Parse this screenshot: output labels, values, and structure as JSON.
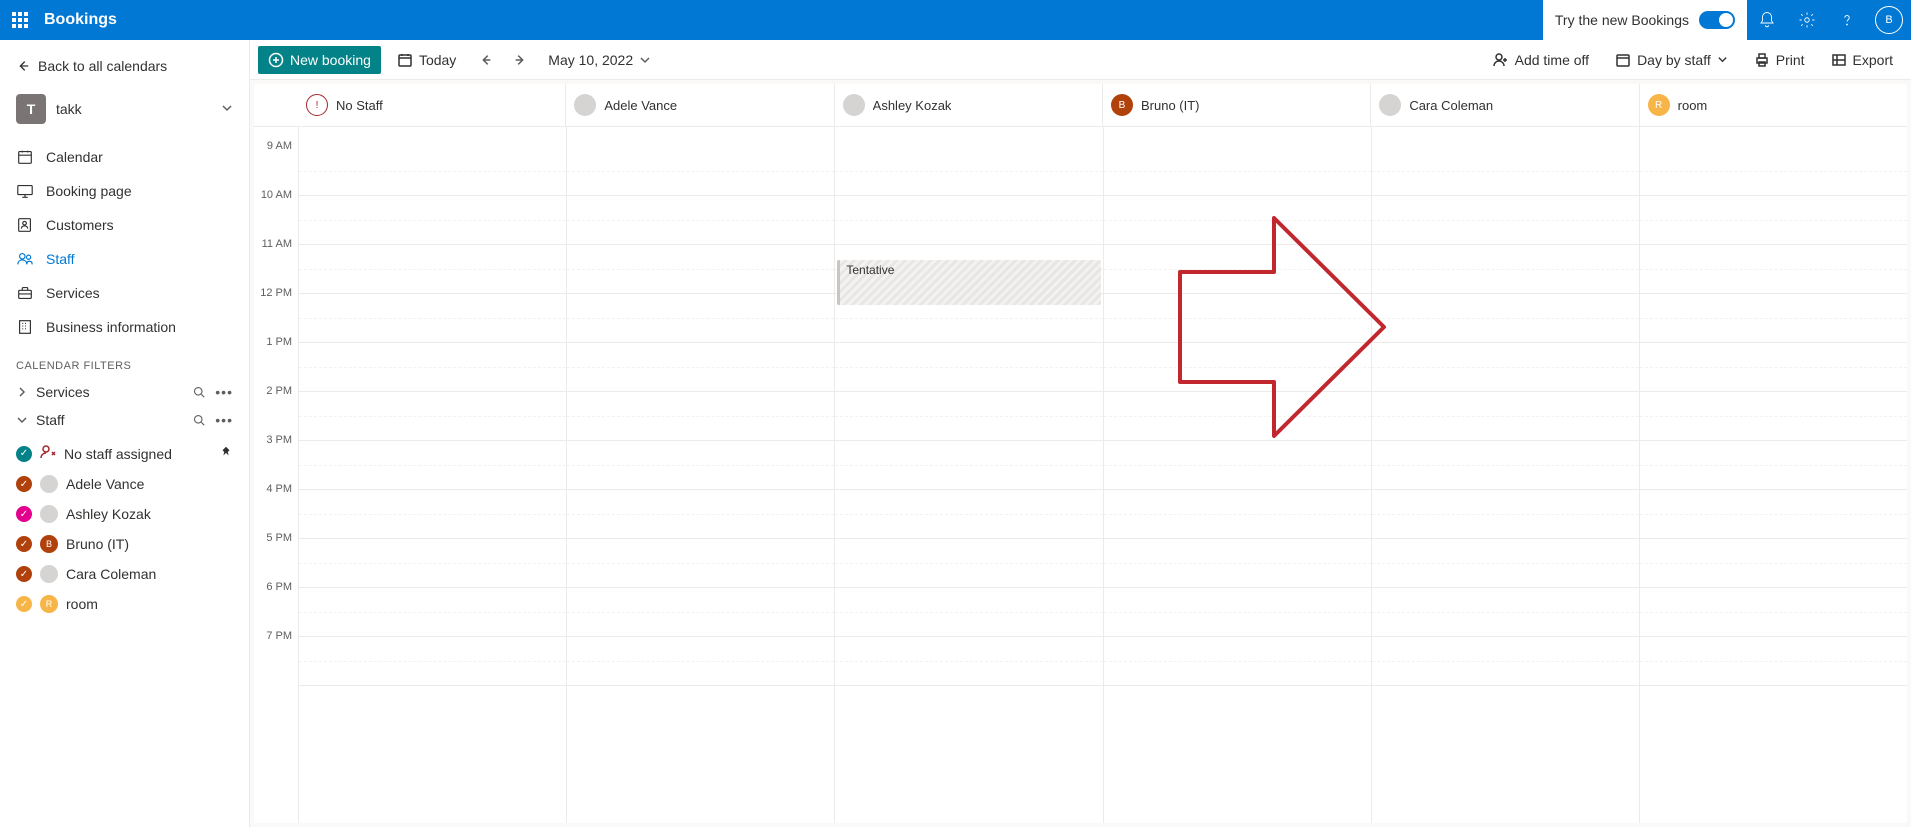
{
  "header": {
    "app_title": "Bookings",
    "try_label": "Try the new Bookings",
    "user_initial": "B"
  },
  "sidebar": {
    "back_label": "Back to all calendars",
    "calendar": {
      "initial": "T",
      "name": "takk"
    },
    "nav": [
      {
        "label": "Calendar",
        "icon": "calendar",
        "active": true
      },
      {
        "label": "Booking page",
        "icon": "monitor",
        "active": false
      },
      {
        "label": "Customers",
        "icon": "contacts",
        "active": false
      },
      {
        "label": "Staff",
        "icon": "people",
        "active": false,
        "highlight": true
      },
      {
        "label": "Services",
        "icon": "briefcase",
        "active": false
      },
      {
        "label": "Business information",
        "icon": "building",
        "active": false
      }
    ],
    "filters_title": "CALENDAR FILTERS",
    "filters": {
      "services_label": "Services",
      "staff_label": "Staff"
    },
    "staff": [
      {
        "label": "No staff assigned",
        "check": "#038387",
        "pinned": true,
        "nostaff": true
      },
      {
        "label": "Adele Vance",
        "check": "#b1410b",
        "avatar_bg": "#d6d4d2",
        "avatar_txt": ""
      },
      {
        "label": "Ashley Kozak",
        "check": "#e3008c",
        "avatar_bg": "#d6d4d2",
        "avatar_txt": ""
      },
      {
        "label": "Bruno (IT)",
        "check": "#b1410b",
        "avatar_bg": "#b1410b",
        "avatar_txt": "B"
      },
      {
        "label": "Cara Coleman",
        "check": "#b1410b",
        "avatar_bg": "#d6d4d2",
        "avatar_txt": ""
      },
      {
        "label": "room",
        "check": "#f7b548",
        "avatar_bg": "#f7b548",
        "avatar_txt": "R"
      }
    ]
  },
  "toolbar": {
    "new_booking": "New booking",
    "today": "Today",
    "date": "May 10, 2022",
    "add_time_off": "Add time off",
    "view": "Day by staff",
    "print": "Print",
    "export": "Export"
  },
  "calendar": {
    "columns": [
      {
        "name": "No Staff",
        "bg": "nostaff",
        "initial": "!"
      },
      {
        "name": "Adele Vance",
        "bg": "#d6d4d2",
        "initial": ""
      },
      {
        "name": "Ashley Kozak",
        "bg": "#d6d4d2",
        "initial": ""
      },
      {
        "name": "Bruno (IT)",
        "bg": "#b1410b",
        "initial": "B"
      },
      {
        "name": "Cara Coleman",
        "bg": "#d6d4d2",
        "initial": ""
      },
      {
        "name": "room",
        "bg": "#f7b548",
        "initial": "R"
      }
    ],
    "hours": [
      "9 AM",
      "10 AM",
      "11 AM",
      "12 PM",
      "1 PM",
      "2 PM",
      "3 PM",
      "4 PM",
      "5 PM",
      "6 PM",
      "7 PM"
    ],
    "event": {
      "title": "Tentative",
      "col": 2,
      "start_idx": 2.3,
      "duration": 1
    }
  }
}
